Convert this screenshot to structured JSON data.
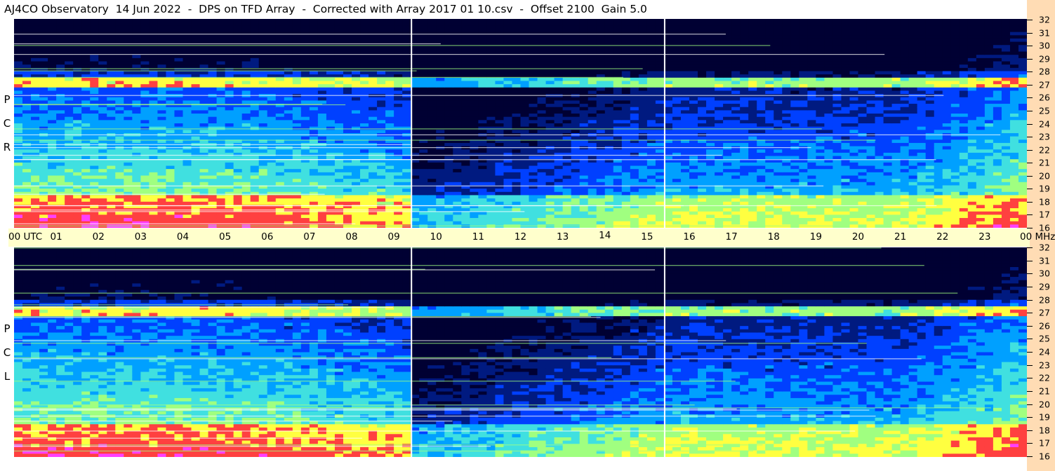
{
  "title": "AJ4CO Observatory  14 Jun 2022  -  DPS on TFD Array  -  Corrected with Array 2017 01 10.csv  -  Offset 2100  Gain 5.0",
  "panels": {
    "top": {
      "letters": [
        "P",
        "C",
        "R"
      ]
    },
    "bottom": {
      "letters": [
        "P",
        "C",
        "L"
      ]
    }
  },
  "time_axis": {
    "labels": [
      "00 UTC",
      "01",
      "02",
      "03",
      "04",
      "05",
      "06",
      "07",
      "08",
      "09",
      "10",
      "11",
      "12",
      "13",
      "14",
      "15",
      "16",
      "17",
      "18",
      "19",
      "20",
      "21",
      "22",
      "23",
      "00 MHz"
    ]
  },
  "chart_data": {
    "type": "heatmap",
    "title": "AJ4CO Observatory  14 Jun 2022  -  DPS on TFD Array  -  Corrected with Array 2017 01 10.csv  -  Offset 2100  Gain 5.0",
    "x_unit": "UTC",
    "y_unit": "MHz",
    "xlim": [
      0,
      24
    ],
    "ylim": [
      16,
      32
    ],
    "y_ticks": [
      16,
      17,
      18,
      19,
      20,
      21,
      22,
      23,
      24,
      25,
      26,
      27,
      28,
      29,
      30,
      31,
      32
    ],
    "panels": [
      "RCP",
      "LCP"
    ],
    "marker_times_utc": [
      9.4,
      15.4
    ],
    "colormap": [
      "#000033",
      "#001a80",
      "#0040ff",
      "#00a0ff",
      "#40e0e0",
      "#a0ff80",
      "#ffff40",
      "#ff4040",
      "#ff40ff"
    ]
  }
}
